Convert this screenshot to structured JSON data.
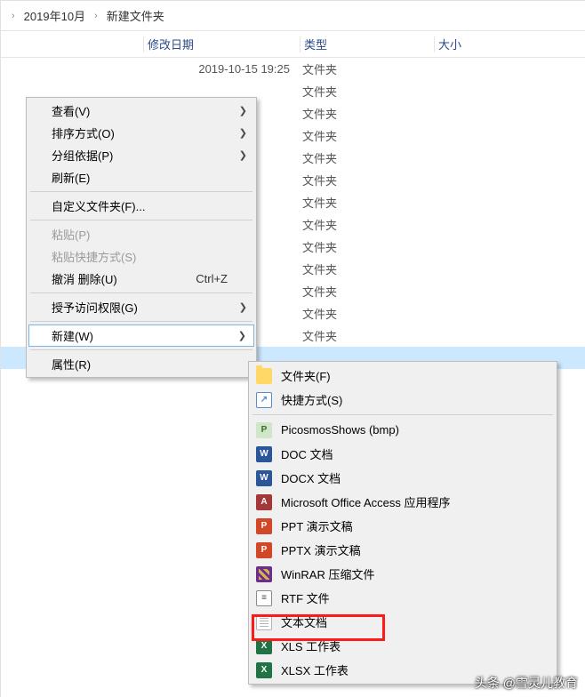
{
  "breadcrumb": {
    "seg1": "2019年10月",
    "seg2": "新建文件夹"
  },
  "columns": {
    "date": "修改日期",
    "type": "类型",
    "size": "大小"
  },
  "rows": [
    {
      "date": "2019-10-15 19:25",
      "type": "文件夹"
    },
    {
      "date": "",
      "type": "文件夹"
    },
    {
      "date": "",
      "type": "文件夹"
    },
    {
      "date": "",
      "type": "文件夹"
    },
    {
      "date": "",
      "type": "文件夹"
    },
    {
      "date": "",
      "type": "文件夹"
    },
    {
      "date": "",
      "type": "文件夹"
    },
    {
      "date": "",
      "type": "文件夹"
    },
    {
      "date": "",
      "type": "文件夹"
    },
    {
      "date": "",
      "type": "文件夹"
    },
    {
      "date": "",
      "type": "文件夹"
    },
    {
      "date": "",
      "type": "文件夹"
    },
    {
      "date": "",
      "type": "文件夹"
    }
  ],
  "ctx": {
    "view": "查看(V)",
    "sort": "排序方式(O)",
    "group": "分组依据(P)",
    "refresh": "刷新(E)",
    "customize": "自定义文件夹(F)...",
    "paste": "粘贴(P)",
    "paste_shortcut": "粘贴快捷方式(S)",
    "undo": "撤消 删除(U)",
    "undo_key": "Ctrl+Z",
    "grant": "授予访问权限(G)",
    "new": "新建(W)",
    "props": "属性(R)"
  },
  "submenu": {
    "folder": "文件夹(F)",
    "shortcut": "快捷方式(S)",
    "bmp": "PicosmosShows (bmp)",
    "doc": "DOC 文档",
    "docx": "DOCX 文档",
    "access": "Microsoft Office Access 应用程序",
    "ppt": "PPT 演示文稿",
    "pptx": "PPTX 演示文稿",
    "rar": "WinRAR 压缩文件",
    "rtf": "RTF 文件",
    "txt": "文本文档",
    "xls": "XLS 工作表",
    "xlsx": "XLSX 工作表"
  },
  "watermark": "头条 @雪灵儿教育"
}
